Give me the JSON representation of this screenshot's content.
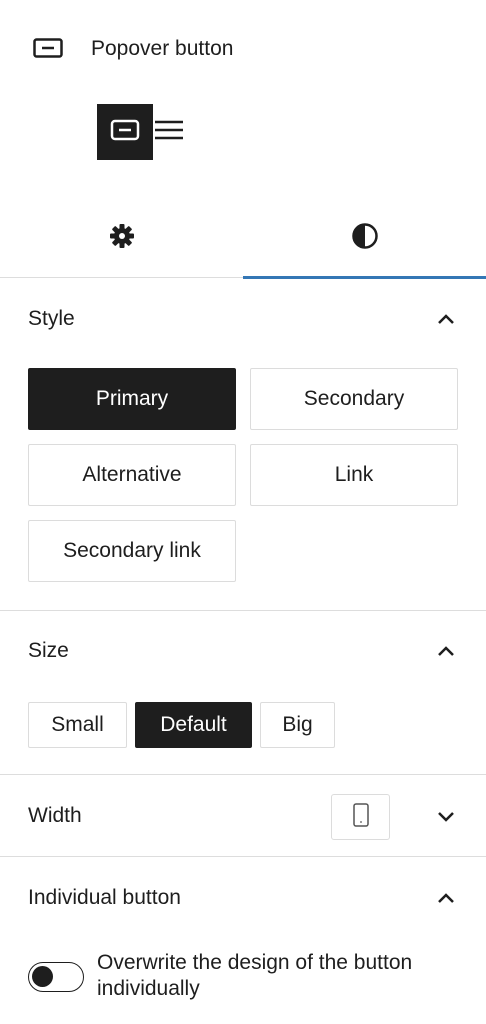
{
  "block": {
    "title": "Popover button",
    "icon": "button-block-icon"
  },
  "variants": [
    {
      "icon": "button-icon",
      "active": true
    },
    {
      "icon": "menu-icon",
      "active": false
    }
  ],
  "tabs": [
    {
      "icon": "gear-icon",
      "label": "Settings",
      "active": false
    },
    {
      "icon": "contrast-icon",
      "label": "Styles",
      "active": true
    }
  ],
  "style_panel": {
    "title": "Style",
    "expanded": true,
    "options": [
      "Primary",
      "Secondary",
      "Alternative",
      "Link",
      "Secondary link"
    ],
    "selected": "Primary"
  },
  "size_panel": {
    "title": "Size",
    "expanded": true,
    "options": [
      "Small",
      "Default",
      "Big"
    ],
    "selected": "Default"
  },
  "width_panel": {
    "title": "Width",
    "expanded": false,
    "device_icon": "mobile-device-icon"
  },
  "individual_panel": {
    "title": "Individual button",
    "expanded": true,
    "toggle_label": "Overwrite the design of the button individually",
    "toggle_on": false
  },
  "colors": {
    "dark": "#1e1e1e",
    "accent": "#3477b5",
    "border": "#dddddd"
  }
}
